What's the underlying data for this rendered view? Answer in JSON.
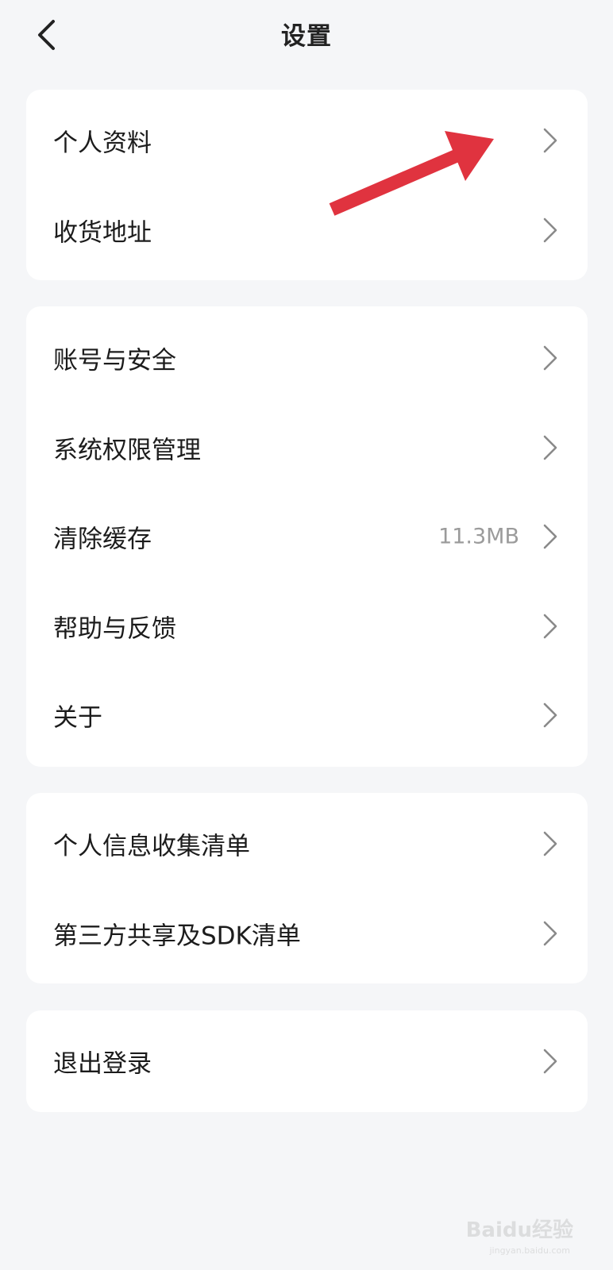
{
  "header": {
    "title": "设置",
    "back_icon": "chevron-left-icon"
  },
  "groups": [
    {
      "items": [
        {
          "label": "个人资料"
        },
        {
          "label": "收货地址"
        }
      ]
    },
    {
      "items": [
        {
          "label": "账号与安全"
        },
        {
          "label": "系统权限管理"
        },
        {
          "label": "清除缓存",
          "value": "11.3MB"
        },
        {
          "label": "帮助与反馈"
        },
        {
          "label": "关于"
        }
      ]
    },
    {
      "items": [
        {
          "label": "个人信息收集清单"
        },
        {
          "label": "第三方共享及SDK清单"
        }
      ]
    },
    {
      "items": [
        {
          "label": "退出登录"
        }
      ]
    }
  ],
  "annotation": {
    "arrow_color": "#e0333f",
    "arrow_icon": "red-arrow-annotation"
  },
  "watermark": {
    "text": "Baidu经验",
    "sub": "jingyan.baidu.com"
  },
  "colors": {
    "background": "#f5f6f8",
    "card": "#ffffff",
    "secondary_text": "#9b9b9b",
    "chevron": "#8a8a8a"
  }
}
